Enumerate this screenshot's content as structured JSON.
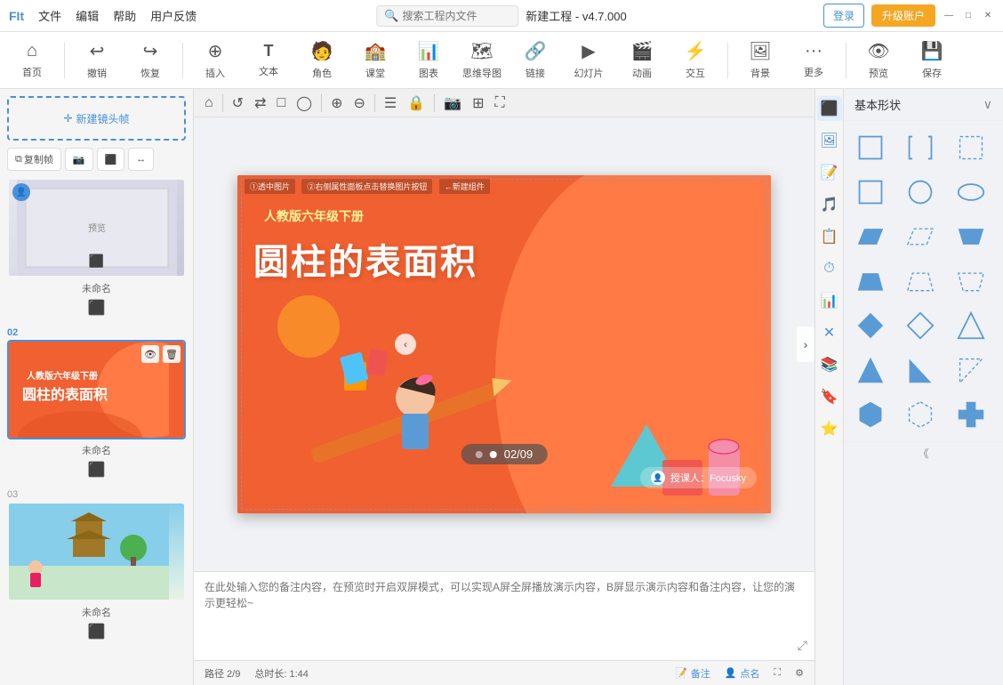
{
  "titlebar": {
    "menus": [
      "文件",
      "编辑",
      "帮助",
      "用户反馈"
    ],
    "title": "新建工程 - v4.7.000",
    "search_placeholder": "搜索工程内文件",
    "login": "登录",
    "upgrade": "升级账户"
  },
  "toolbar": {
    "items": [
      {
        "id": "home",
        "label": "首页",
        "icon": "🏠"
      },
      {
        "id": "undo",
        "label": "撤销",
        "icon": "↩"
      },
      {
        "id": "redo",
        "label": "恢复",
        "icon": "↪"
      },
      {
        "id": "insert",
        "label": "插入",
        "icon": "⊕"
      },
      {
        "id": "text",
        "label": "文本",
        "icon": "T"
      },
      {
        "id": "character",
        "label": "角色",
        "icon": "👤"
      },
      {
        "id": "lesson",
        "label": "课堂",
        "icon": "🏫"
      },
      {
        "id": "chart",
        "label": "图表",
        "icon": "📊"
      },
      {
        "id": "mindmap",
        "label": "思维导图",
        "icon": "🗺"
      },
      {
        "id": "link",
        "label": "链接",
        "icon": "🔗"
      },
      {
        "id": "slide",
        "label": "幻灯片",
        "icon": "▶"
      },
      {
        "id": "animation",
        "label": "动画",
        "icon": "🎬"
      },
      {
        "id": "interact",
        "label": "交互",
        "icon": "⚡"
      },
      {
        "id": "bg",
        "label": "背景",
        "icon": "🖼"
      },
      {
        "id": "more",
        "label": "更多",
        "icon": "···"
      },
      {
        "id": "preview",
        "label": "预览",
        "icon": "👁"
      },
      {
        "id": "save",
        "label": "保存",
        "icon": "💾"
      }
    ]
  },
  "slides": {
    "new_frame_label": "新建镜头帧",
    "actions": [
      "复制帧",
      "📷",
      "🔲",
      "↔"
    ],
    "list": [
      {
        "num": "",
        "name": "未命名",
        "active": false
      },
      {
        "num": "02",
        "name": "未命名",
        "active": true
      },
      {
        "num": "03",
        "name": "未命名",
        "active": false
      }
    ]
  },
  "canvas": {
    "subtitle": "人教版六年级下册",
    "title": "圆柱的表面积",
    "author": "授课人：Focusky",
    "annotations": [
      "①透中图片",
      "②右侧属性面板点击替换图片按钮",
      "←新建组件"
    ],
    "counter": "02/09",
    "notes_placeholder": "在此处输入您的备注内容，在预览时开启双屏模式，可以实现A屏全屏播放演示内容，B屏显示演示内容和备注内容，让您的演示更轻松~"
  },
  "shapes_panel": {
    "title": "基本形状",
    "categories": [
      {
        "icon": "⬛",
        "label": "shapes"
      },
      {
        "icon": "🖼",
        "label": "image"
      },
      {
        "icon": "📝",
        "label": "text"
      },
      {
        "icon": "🎵",
        "label": "audio"
      },
      {
        "icon": "📋",
        "label": "table"
      },
      {
        "icon": "⏱",
        "label": "timer"
      },
      {
        "icon": "📊",
        "label": "data"
      },
      {
        "icon": "❌",
        "label": "close"
      },
      {
        "icon": "📚",
        "label": "layers"
      },
      {
        "icon": "🔖",
        "label": "bookmark"
      },
      {
        "icon": "⭐",
        "label": "star"
      }
    ]
  },
  "statusbar": {
    "path": "路径 2/9",
    "total": "总时长: 1:44",
    "notes_label": "备注",
    "pointer_label": "点名"
  },
  "colors": {
    "accent": "#4a90d9",
    "orange": "#f06030",
    "upgrade_bg": "#f5a623"
  }
}
